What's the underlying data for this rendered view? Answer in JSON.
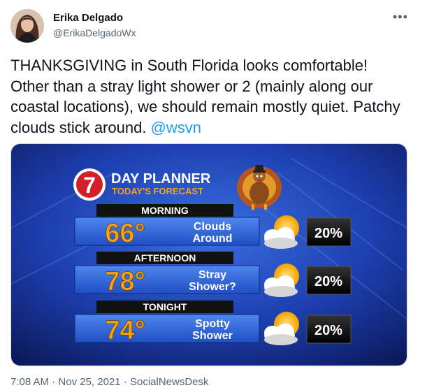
{
  "author": {
    "name": "Erika Delgado",
    "handle": "@ErikaDelgadoWx"
  },
  "more_icon": "more-horizontal-icon",
  "tweet": {
    "text": "THANKSGIVING in South Florida looks comfortable! Other than a stray light shower or 2 (mainly along our coastal locations), we should remain mostly quiet. Patchy clouds stick around. ",
    "mention": "@wsvn"
  },
  "graphic": {
    "logo_number": "7",
    "title": "DAY PLANNER",
    "subtitle": "TODAY'S FORECAST",
    "periods": [
      {
        "label": "MORNING",
        "temp": "66°",
        "cond_line1": "Clouds",
        "cond_line2": "Around",
        "pop": "20%",
        "icon": "partly-cloudy-icon"
      },
      {
        "label": "AFTERNOON",
        "temp": "78°",
        "cond_line1": "Stray",
        "cond_line2": "Shower?",
        "pop": "20%",
        "icon": "partly-cloudy-icon"
      },
      {
        "label": "TONIGHT",
        "temp": "74°",
        "cond_line1": "Spotty",
        "cond_line2": "Shower",
        "pop": "20%",
        "icon": "partly-cloudy-icon"
      }
    ],
    "colors": {
      "background": "#1d3fb0",
      "panel": "#2a63d6",
      "temp": "#f5a21b",
      "label_bar": "#111111"
    }
  },
  "meta": {
    "time": "7:08 AM",
    "date": "Nov 25, 2021",
    "separator": "·",
    "source": "SocialNewsDesk"
  }
}
